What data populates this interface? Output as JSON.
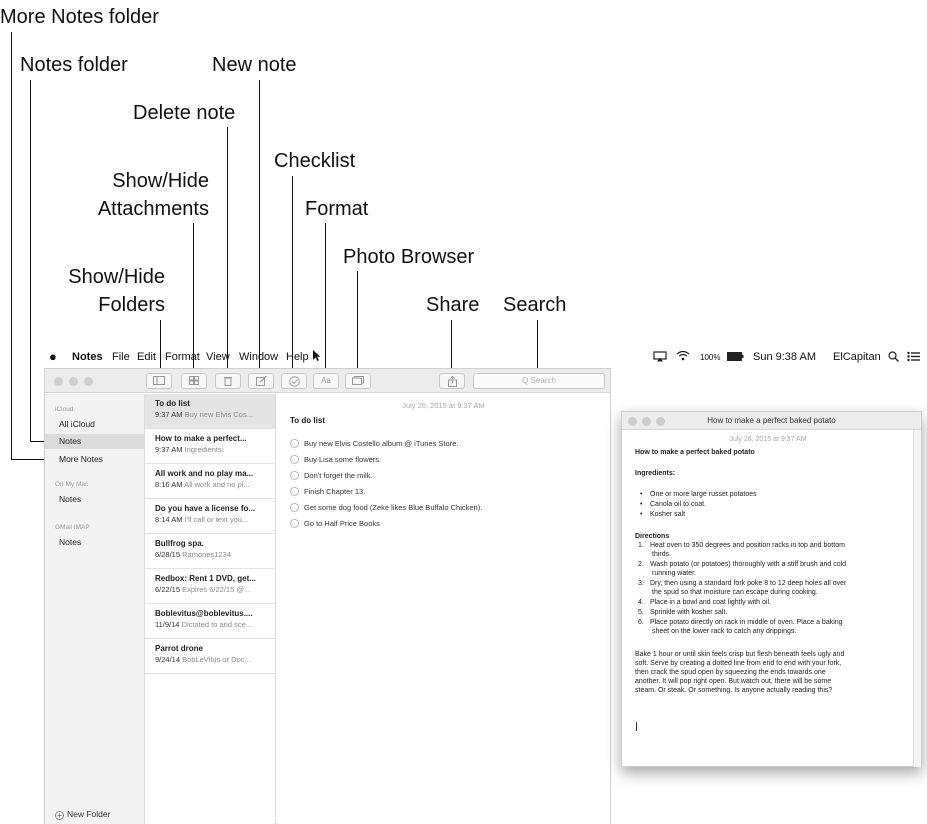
{
  "callouts": {
    "more_notes_folder": "More Notes folder",
    "notes_folder": "Notes folder",
    "new_note": "New note",
    "delete_note": "Delete note",
    "checklist": "Checklist",
    "show_hide_attachments_1": "Show/Hide",
    "show_hide_attachments_2": "Attachments",
    "format": "Format",
    "photo_browser": "Photo Browser",
    "show_hide_folders_1": "Show/Hide",
    "show_hide_folders_2": "Folders",
    "share": "Share",
    "search": "Search"
  },
  "menubar": {
    "apple": "",
    "app": "Notes",
    "items": [
      "File",
      "Edit",
      "Format",
      "View",
      "Window",
      "Help"
    ],
    "battery": "100%",
    "clock": "Sun 9:38 AM",
    "user": "ElCapitan"
  },
  "toolbar": {
    "search_placeholder": "Q Search"
  },
  "sidebar": {
    "icloud_header": "iCloud",
    "all_icloud": "All iCloud",
    "notes": "Notes",
    "more_notes": "More Notes",
    "onmymac_header": "On My Mac",
    "mac_notes": "Notes",
    "gmail_header": "GMail IMAP",
    "gmail_notes": "Notes",
    "new_folder": "New Folder"
  },
  "notes": [
    {
      "title": "To do list",
      "time": "9:37 AM",
      "preview": "Buy new Elvis Cos..."
    },
    {
      "title": "How to make a perfect...",
      "time": "9:37 AM",
      "preview": "Ingredients:"
    },
    {
      "title": "All work and no play ma...",
      "time": "8:16 AM",
      "preview": "All work and no pl..."
    },
    {
      "title": "Do you have a license fo...",
      "time": "8:14 AM",
      "preview": "I'll call or text you..."
    },
    {
      "title": "Bullfrog spa.",
      "time": "6/28/15",
      "preview": "Ramones1234"
    },
    {
      "title": "Redbox: Rent 1 DVD, get...",
      "time": "6/22/15",
      "preview": "Expires 6/22/15 @..."
    },
    {
      "title": "Boblevitus@boblevitus....",
      "time": "11/9/14",
      "preview": "Dictated to and sce..."
    },
    {
      "title": "Parrot drone",
      "time": "9/24/14",
      "preview": "BobLeVitus or Doc..."
    }
  ],
  "editor": {
    "date": "July 26, 2015 at 9:37 AM",
    "title": "To do list",
    "checklist": [
      "Buy new Elvis Costello album @ iTunes Store.",
      "Buy Lisa some flowers.",
      "Don't forget the milk.",
      "Finish Chapter 13.",
      "Get some dog food (Zeke likes Blue Buffalo Chicken).",
      "Go to Half Price Books"
    ]
  },
  "window2": {
    "title": "How to make a perfect baked potato",
    "date": "July 26, 2015 at 9:37 AM",
    "heading": "How to make a perfect baked potato",
    "ingredients_label": "Ingredients:",
    "ingredients": [
      "One or more large russet potatoes",
      "Canola oil to coat.",
      "Kosher salt"
    ],
    "directions_label": "Directions",
    "directions": [
      [
        "1.",
        "Heat oven to 350 degrees and position racks in top and bottom",
        "thirds."
      ],
      [
        "2.",
        "Wash potato (or potatoes) thoroughly with a stiff brush and cold",
        "running water."
      ],
      [
        "3.",
        "Dry, then using a standard fork poke 8 to 12 deep holes all over",
        "the spud so that moisture can escape during cooking."
      ],
      [
        "4.",
        "Place in a bowl and coat lightly with oil.",
        ""
      ],
      [
        "5.",
        "Sprinkle with kosher salt.",
        ""
      ],
      [
        "6.",
        "Place potato directly on rack in middle of oven. Place a baking",
        "sheet on the lower rack to catch any drippings."
      ]
    ],
    "paragraph": [
      "Bake 1 hour or until skin feels crisp but flesh beneath feels ugly and",
      "soft. Serve by creating a dotted line from end to end with your fork,",
      "then crack the spud open by squeezing the ends towards one",
      "another. It will pop right open. But watch out, there will be some",
      "steam. Or steak. Or something. Is anyone actually reading this?"
    ]
  }
}
